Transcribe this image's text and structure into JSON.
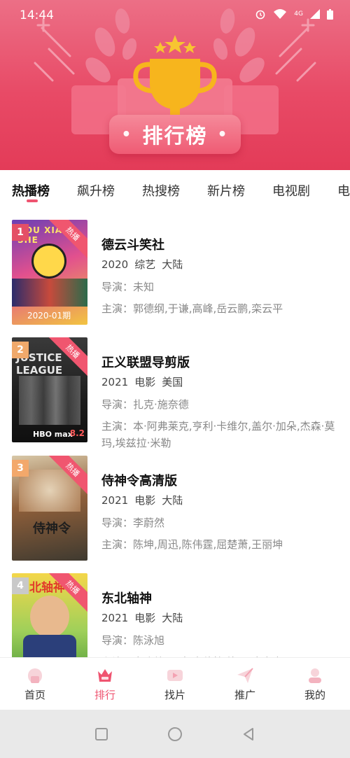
{
  "status": {
    "time": "14:44",
    "network": "4G"
  },
  "header": {
    "title": "排行榜"
  },
  "tabs": [
    {
      "label": "热播榜",
      "active": true
    },
    {
      "label": "飙升榜"
    },
    {
      "label": "热搜榜"
    },
    {
      "label": "新片榜"
    },
    {
      "label": "电视剧"
    },
    {
      "label": "电影"
    }
  ],
  "ribbon_label": "热播",
  "items": [
    {
      "rank": "1",
      "rank_color": "#e44f66",
      "title": "德云斗笑社",
      "year": "2020",
      "type": "综艺",
      "region": "大陆",
      "director": "导演：未知",
      "cast": "主演：郭德纲,于谦,高峰,岳云鹏,栾云平",
      "poster_text": "DOU XIAO SHE",
      "poster_caption": "2020-01期"
    },
    {
      "rank": "2",
      "rank_color": "#f0a96b",
      "title": "正义联盟导剪版",
      "year": "2021",
      "type": "电影",
      "region": "美国",
      "director": "导演：扎克·施奈德",
      "cast": "主演：本·阿弗莱克,亨利·卡维尔,盖尔·加朵,杰森·莫玛,埃兹拉·米勒",
      "poster_text": "JUSTICE LEAGUE",
      "poster_caption": "HBO max",
      "poster_score": "8.2"
    },
    {
      "rank": "3",
      "rank_color": "#f3a86b",
      "title": "侍神令高清版",
      "year": "2021",
      "type": "电影",
      "region": "大陆",
      "director": "导演：李蔚然",
      "cast": "主演：陈坤,周迅,陈伟霆,屈楚萧,王丽坤",
      "poster_text": "侍神令"
    },
    {
      "rank": "4",
      "rank_color": "#c9c9c9",
      "title": "东北轴神",
      "year": "2021",
      "type": "电影",
      "region": "大陆",
      "director": "导演：陈泳旭",
      "cast": "主演：宋晓峰,贾冰,李佳怡,毕雪,唐白虎",
      "poster_text": "东北轴神"
    }
  ],
  "nav": [
    {
      "label": "首页",
      "icon": "home-icon"
    },
    {
      "label": "排行",
      "icon": "crown-icon",
      "active": true
    },
    {
      "label": "找片",
      "icon": "video-icon"
    },
    {
      "label": "推广",
      "icon": "send-icon"
    },
    {
      "label": "我的",
      "icon": "user-icon"
    }
  ],
  "colors": {
    "accent": "#ef5470",
    "header_top": "#ec6f86",
    "header_bottom": "#e33b58",
    "trophy": "#f7b51d"
  }
}
